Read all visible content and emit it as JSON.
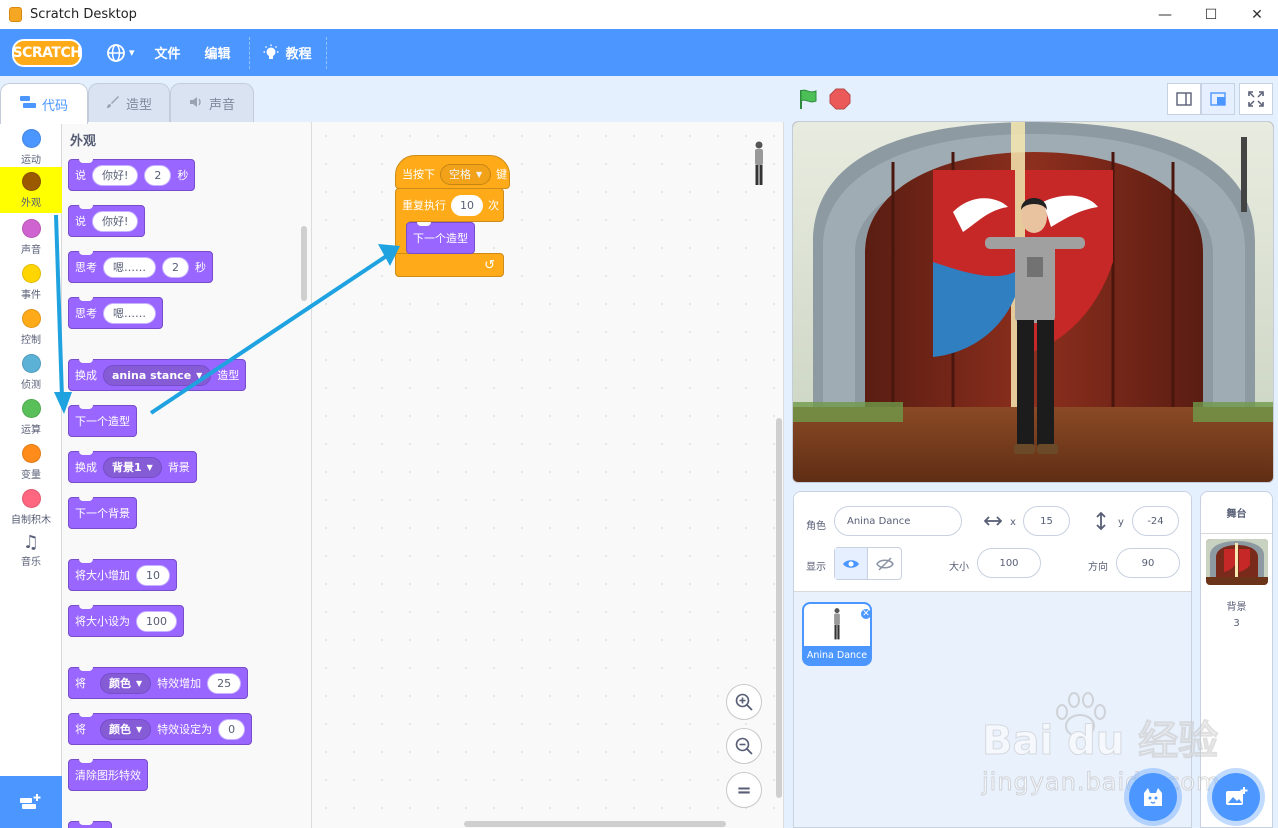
{
  "window": {
    "title": "Scratch Desktop",
    "minimize": "—",
    "maximize": "☐",
    "close": "✕"
  },
  "menubar": {
    "logo": "SCRATCH",
    "language_arrow": "▾",
    "file": "文件",
    "edit": "编辑",
    "tutorials": "教程"
  },
  "tabs": {
    "code": "代码",
    "costumes": "造型",
    "sounds": "声音"
  },
  "categories": [
    {
      "label": "运动",
      "color": "#4c97ff"
    },
    {
      "label": "外观",
      "color": "#9b5a00"
    },
    {
      "label": "声音",
      "color": "#cf63cf"
    },
    {
      "label": "事件",
      "color": "#ffd500"
    },
    {
      "label": "控制",
      "color": "#ffab19"
    },
    {
      "label": "侦测",
      "color": "#5cb1d6"
    },
    {
      "label": "运算",
      "color": "#59c059"
    },
    {
      "label": "变量",
      "color": "#ff8c1a"
    },
    {
      "label": "自制积木",
      "color": "#ff6680"
    },
    {
      "label": "音乐",
      "color": "#575e75"
    }
  ],
  "palette": {
    "title": "外观",
    "say_for": {
      "verb": "说",
      "msg": "你好!",
      "secs": "2",
      "unit": "秒"
    },
    "say": {
      "verb": "说",
      "msg": "你好!"
    },
    "think_for": {
      "verb": "思考",
      "msg": "嗯……",
      "secs": "2",
      "unit": "秒"
    },
    "think": {
      "verb": "思考",
      "msg": "嗯……"
    },
    "switch_costume": {
      "verb": "换成",
      "value": "anina stance",
      "suffix": "造型"
    },
    "next_costume": "下一个造型",
    "switch_backdrop": {
      "verb": "换成",
      "value": "背景1",
      "suffix": "背景"
    },
    "next_backdrop": "下一个背景",
    "change_size": {
      "label": "将大小增加",
      "value": "10"
    },
    "set_size": {
      "label": "将大小设为",
      "value": "100"
    },
    "change_effect": {
      "verb": "将",
      "effect": "颜色",
      "label": "特效增加",
      "value": "25"
    },
    "set_effect": {
      "verb": "将",
      "effect": "颜色",
      "label": "特效设定为",
      "value": "0"
    },
    "clear_effects": "清除图形特效"
  },
  "script": {
    "when_key": {
      "prefix": "当按下",
      "key": "空格",
      "suffix": "键"
    },
    "repeat": {
      "prefix": "重复执行",
      "times": "10",
      "suffix": "次"
    },
    "inner": "下一个造型",
    "loop_arrow": "↺"
  },
  "zoom": {
    "in": "⊕",
    "out": "⊖",
    "reset": "="
  },
  "sprite_info": {
    "sprite_label": "角色",
    "sprite_name": "Anina Dance",
    "x_label": "x",
    "x_value": "15",
    "y_label": "y",
    "y_value": "-24",
    "show_label": "显示",
    "size_label": "大小",
    "size_value": "100",
    "direction_label": "方向",
    "direction_value": "90"
  },
  "sprites": [
    {
      "name": "Anina Dance"
    }
  ],
  "stage_panel": {
    "title": "舞台",
    "backdrops_label": "背景",
    "backdrops_count": "3"
  },
  "watermark": {
    "main": "Bai du 经验",
    "sub": "jingyan.baidu.com"
  },
  "colors": {
    "menubar": "#4c97ff",
    "looks": "#9966ff",
    "control": "#ffab19",
    "highlight": "#ffff00",
    "annotation_arrow": "#1fa2e0"
  }
}
